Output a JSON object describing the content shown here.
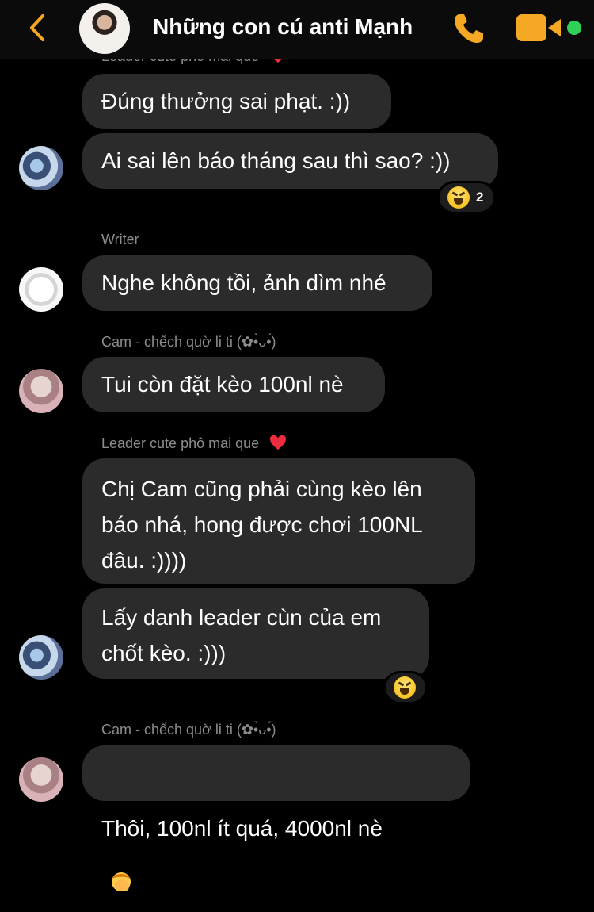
{
  "header": {
    "title": "Những con cú anti Mạnh",
    "back_icon": "back-chevron-icon",
    "call_icon": "phone-icon",
    "video_icon": "video-call-icon",
    "accent_color": "#f4a823",
    "online_color": "#31d158"
  },
  "partial_sender": "Leader cute phô mai que",
  "messages": {
    "m1": "Đúng thưởng sai phạt. :))",
    "m2": "Ai sai lên báo tháng sau thì sao? :))",
    "m2_reaction_count": "2",
    "sender_writer": "Writer",
    "m3": "Nghe không tồi, ảnh dìm nhé",
    "sender_cam": "Cam - chếch quờ li ti (✿•̀ᴗ•́)",
    "m4": "Tui còn đặt kèo 100nl nè",
    "sender_leader": "Leader cute phô mai que",
    "m5": "Chị Cam cũng phải cùng kèo lên\nbáo nhá, hong được chơi 100NL\nđâu. :))))",
    "m6": "Lấy danh leader cùn của em\nchốt kèo. :)))",
    "sender_cam2": "Cam - chếch quờ li ti (✿•̀ᴗ•́)",
    "m7": "Thôi, 100nl ít quá, 4000nl nè"
  }
}
